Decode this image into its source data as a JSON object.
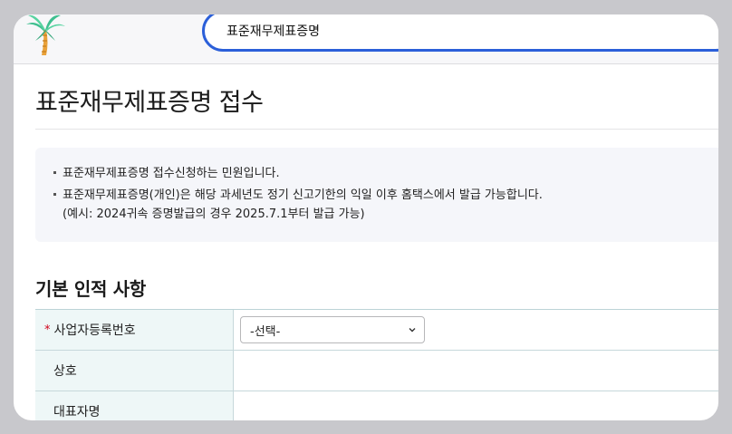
{
  "header": {
    "search_value": "표준재무제표증명"
  },
  "page": {
    "title": "표준재무제표증명 접수"
  },
  "notice": {
    "items": [
      "표준재무제표증명 접수신청하는 민원입니다.",
      "표준재무제표증명(개인)은 해당 과세년도 정기 신고기한의 익일 이후 홈택스에서 발급 가능합니다."
    ],
    "example": "(예시: 2024귀속 증명발급의 경우 2025.7.1부터 발급 가능)"
  },
  "section": {
    "title": "기본 인적 사항"
  },
  "form": {
    "required_mark": "*",
    "rows": [
      {
        "label": "사업자등록번호",
        "select_value": "-선택-"
      },
      {
        "label": "상호"
      },
      {
        "label": "대표자명"
      }
    ]
  },
  "colors": {
    "accent": "#2b5fd9",
    "required": "#d0021b",
    "label_bg": "#eef7f7"
  }
}
